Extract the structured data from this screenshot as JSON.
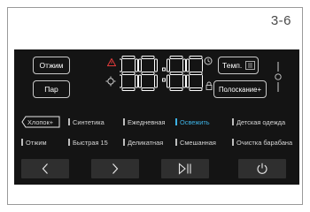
{
  "page": {
    "number": "3-6"
  },
  "buttons": {
    "spin": "Отжим",
    "steam": "Пар",
    "temp": "Темп.",
    "rinse_plus": "Полоскание+"
  },
  "display": {
    "digits": "88:88"
  },
  "programs_row1": [
    {
      "label": "Хлопок+",
      "state": "selected"
    },
    {
      "label": "Синтетика",
      "state": "normal"
    },
    {
      "label": "Ежедневная",
      "state": "normal"
    },
    {
      "label": "Освежить",
      "state": "active"
    },
    {
      "label": "Детская одежда",
      "state": "normal"
    }
  ],
  "programs_row2": [
    {
      "label": "Отжим",
      "state": "normal"
    },
    {
      "label": "Быстрая 15",
      "state": "normal"
    },
    {
      "label": "Деликатная",
      "state": "normal"
    },
    {
      "label": "Смешанная",
      "state": "normal"
    },
    {
      "label": "Очистка барабана",
      "state": "normal"
    }
  ],
  "navigation": [
    "previous-icon",
    "next-icon",
    "play-pause-icon",
    "power-icon"
  ],
  "colors": {
    "panel": "#141414",
    "accent_blue": "#3db3e6",
    "warning_red": "#e23b3b",
    "segment_white": "#ffffff"
  }
}
